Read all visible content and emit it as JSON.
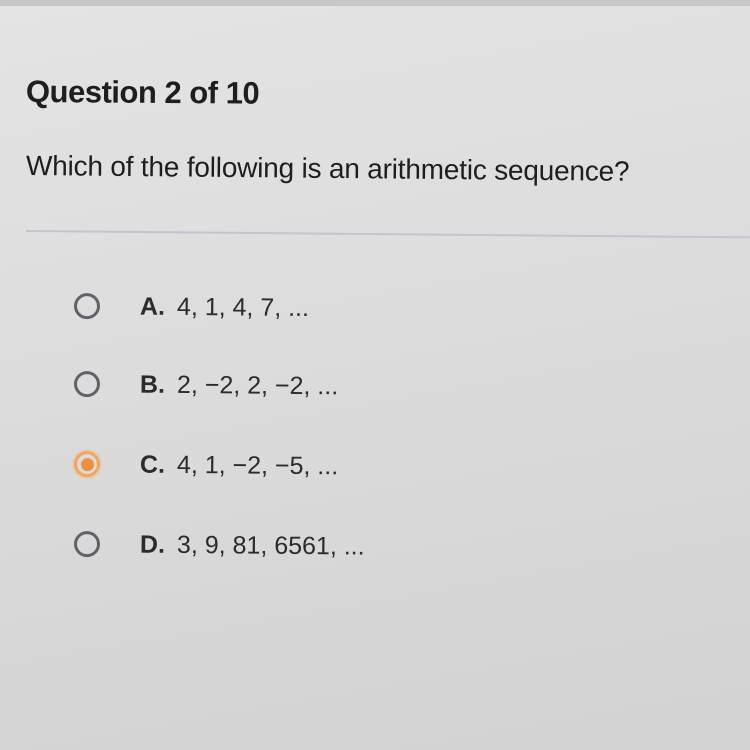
{
  "quiz": {
    "question_counter": "Question 2 of 10",
    "question_text": "Which of the following is an arithmetic sequence?",
    "selected_option": "C",
    "options": [
      {
        "letter": "A.",
        "text": "4, 1, 4, 7, ..."
      },
      {
        "letter": "B.",
        "text": "2, −2, 2, −2, ..."
      },
      {
        "letter": "C.",
        "text": "4, 1, −2, −5, ..."
      },
      {
        "letter": "D.",
        "text": "3, 9, 81, 6561, ..."
      }
    ]
  },
  "colors": {
    "selected_radio": "#ee8f3f",
    "radio_border": "#5f6369",
    "divider": "#bfc6cf"
  }
}
